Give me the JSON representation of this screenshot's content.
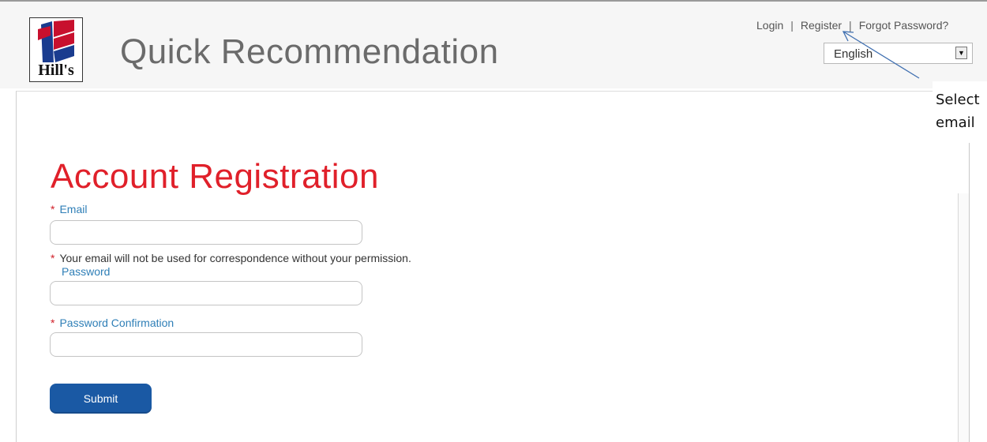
{
  "header": {
    "logo_text": "Hill's",
    "app_title": "Quick Recommendation",
    "nav": {
      "login": "Login",
      "separator": "|",
      "register": "Register",
      "forgot": "Forgot Password?"
    },
    "language": {
      "selected": "English"
    }
  },
  "form": {
    "title": "Account Registration",
    "required_mark": "*",
    "email_label": "Email",
    "email_value": "",
    "email_note": "Your email will not be used for correspondence without your permission.",
    "password_label": "Password",
    "password_value": "",
    "confirm_label": "Password Confirmation",
    "confirm_value": "",
    "submit_label": "Submit"
  },
  "annotation": {
    "line1": "Select",
    "line2": "email"
  },
  "colors": {
    "title_red": "#e0202a",
    "label_blue": "#2f7fb7",
    "button_blue": "#1a59a4",
    "required_red": "#d01f28"
  },
  "icons": [
    "hills-logo",
    "chevron-down-icon"
  ]
}
